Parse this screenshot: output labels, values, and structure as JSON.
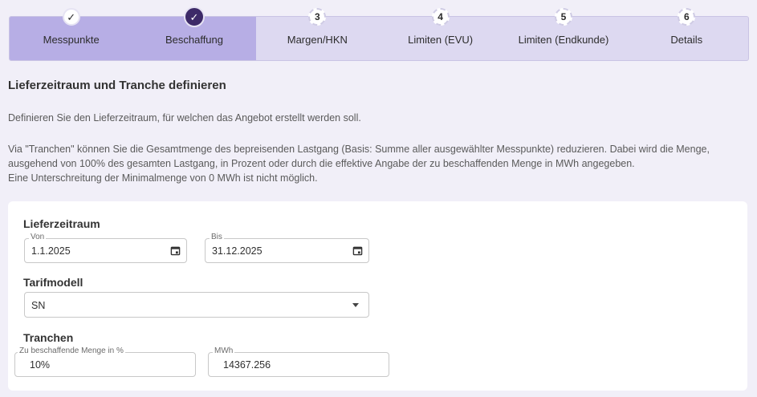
{
  "stepper": {
    "steps": [
      {
        "marker": "✓",
        "label": "Messpunkte",
        "state": "done"
      },
      {
        "marker": "✓",
        "label": "Beschaffung",
        "state": "active"
      },
      {
        "marker": "3",
        "label": "Margen/HKN",
        "state": "todo"
      },
      {
        "marker": "4",
        "label": "Limiten (EVU)",
        "state": "todo"
      },
      {
        "marker": "5",
        "label": "Limiten (Endkunde)",
        "state": "todo"
      },
      {
        "marker": "6",
        "label": "Details",
        "state": "todo"
      }
    ]
  },
  "page": {
    "title": "Lieferzeitraum und Tranche definieren",
    "intro": "Definieren Sie den Lieferzeitraum, für welchen das Angebot erstellt werden soll.",
    "tranche_info": "Via \"Tranchen\" können Sie die Gesamtmenge des bepreisenden Lastgang (Basis: Summe aller ausgewählter Messpunkte) reduzieren. Dabei wird die Menge, ausgehend von 100% des gesamten Lastgang, in Prozent oder durch die effektive Angabe der zu beschaffenden Menge in MWh angegeben.",
    "tranche_min": "Eine Unterschreitung der Minimalmenge von 0 MWh ist nicht möglich."
  },
  "form": {
    "lieferzeitraum": {
      "label": "Lieferzeitraum",
      "von_label": "Von",
      "von_value": "1.1.2025",
      "bis_label": "Bis",
      "bis_value": "31.12.2025"
    },
    "tarifmodell": {
      "label": "Tarifmodell",
      "value": "SN"
    },
    "tranchen": {
      "label": "Tranchen",
      "percent_label": "Zu beschaffende Menge in %",
      "percent_value": "10%",
      "mwh_label": "MWh",
      "mwh_value": "14367.256"
    }
  },
  "colors": {
    "accent": "#3d2a68",
    "stepper_done": "#b7aee5",
    "stepper_bg": "#ddd9f1"
  }
}
